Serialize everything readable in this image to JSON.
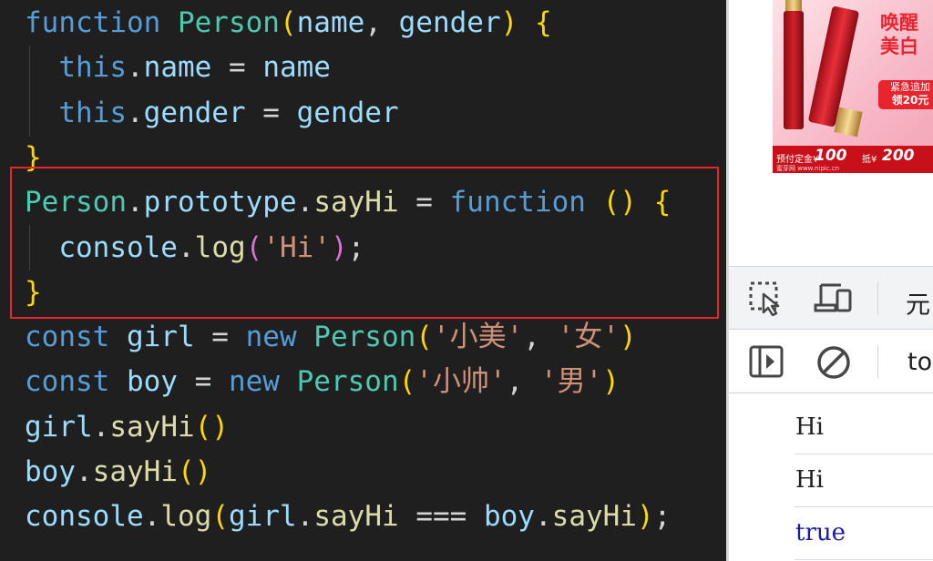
{
  "editor": {
    "lines": [
      [
        [
          "kw",
          "function "
        ],
        [
          "cls",
          "Person"
        ],
        [
          "br1",
          "("
        ],
        [
          "var",
          "name"
        ],
        [
          "pl",
          ", "
        ],
        [
          "var",
          "gender"
        ],
        [
          "br1",
          ")"
        ],
        [
          "pl",
          " "
        ],
        [
          "br1",
          "{"
        ]
      ],
      [
        [
          "pl",
          "  "
        ],
        [
          "kw",
          "this"
        ],
        [
          "pl",
          "."
        ],
        [
          "var",
          "name"
        ],
        [
          "pl",
          " = "
        ],
        [
          "var",
          "name"
        ]
      ],
      [
        [
          "pl",
          "  "
        ],
        [
          "kw",
          "this"
        ],
        [
          "pl",
          "."
        ],
        [
          "var",
          "gender"
        ],
        [
          "pl",
          " = "
        ],
        [
          "var",
          "gender"
        ]
      ],
      [
        [
          "br1",
          "}"
        ]
      ],
      [
        [
          "cls",
          "Person"
        ],
        [
          "pl",
          "."
        ],
        [
          "var",
          "prototype"
        ],
        [
          "pl",
          "."
        ],
        [
          "fn",
          "sayHi"
        ],
        [
          "pl",
          " = "
        ],
        [
          "kw",
          "function"
        ],
        [
          "pl",
          " "
        ],
        [
          "br1",
          "()"
        ],
        [
          "pl",
          " "
        ],
        [
          "br1",
          "{"
        ]
      ],
      [
        [
          "pl",
          "  "
        ],
        [
          "var",
          "console"
        ],
        [
          "pl",
          "."
        ],
        [
          "fn",
          "log"
        ],
        [
          "br2",
          "("
        ],
        [
          "str",
          "'Hi'"
        ],
        [
          "br2",
          ")"
        ],
        [
          "pl",
          ";"
        ]
      ],
      [
        [
          "br1",
          "}"
        ]
      ],
      [
        [
          "kw",
          "const "
        ],
        [
          "var",
          "girl"
        ],
        [
          "pl",
          " = "
        ],
        [
          "kw",
          "new "
        ],
        [
          "cls",
          "Person"
        ],
        [
          "br1",
          "("
        ],
        [
          "str",
          "'小美'"
        ],
        [
          "pl",
          ", "
        ],
        [
          "str",
          "'女'"
        ],
        [
          "br1",
          ")"
        ]
      ],
      [
        [
          "kw",
          "const "
        ],
        [
          "var",
          "boy"
        ],
        [
          "pl",
          " = "
        ],
        [
          "kw",
          "new "
        ],
        [
          "cls",
          "Person"
        ],
        [
          "br1",
          "("
        ],
        [
          "str",
          "'小帅'"
        ],
        [
          "pl",
          ", "
        ],
        [
          "str",
          "'男'"
        ],
        [
          "br1",
          ")"
        ]
      ],
      [
        [
          "var",
          "girl"
        ],
        [
          "pl",
          "."
        ],
        [
          "fn",
          "sayHi"
        ],
        [
          "br1",
          "()"
        ]
      ],
      [
        [
          "var",
          "boy"
        ],
        [
          "pl",
          "."
        ],
        [
          "fn",
          "sayHi"
        ],
        [
          "br1",
          "()"
        ]
      ],
      [
        [
          "var",
          "console"
        ],
        [
          "pl",
          "."
        ],
        [
          "fn",
          "log"
        ],
        [
          "br1",
          "("
        ],
        [
          "var",
          "girl"
        ],
        [
          "pl",
          "."
        ],
        [
          "fn",
          "sayHi"
        ],
        [
          "pl",
          " === "
        ],
        [
          "var",
          "boy"
        ],
        [
          "pl",
          "."
        ],
        [
          "fn",
          "sayHi"
        ],
        [
          "br1",
          ")"
        ],
        [
          "pl",
          ";"
        ]
      ]
    ]
  },
  "ad": {
    "title_line1": "唤醒",
    "title_line2": "美白",
    "badge_line1": "紧急追加",
    "badge_line2": "领20元",
    "deposit_label": "预付定金¥",
    "deposit_value": "100",
    "deduct_label": "抵¥",
    "deduct_value": "200",
    "source": "蜜芽网 www.nipic.cn"
  },
  "devtools": {
    "tab_partial": "元",
    "filter_partial": "to",
    "console_output": [
      {
        "text": "Hi",
        "kind": "string"
      },
      {
        "text": "Hi",
        "kind": "string"
      },
      {
        "text": "true",
        "kind": "boolean"
      }
    ]
  }
}
